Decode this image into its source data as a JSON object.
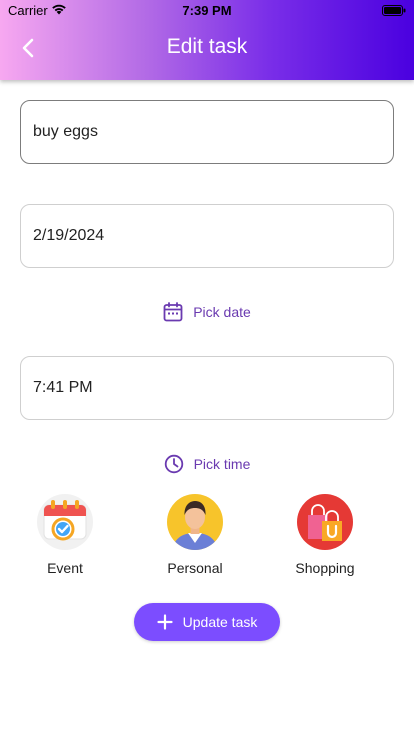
{
  "status_bar": {
    "carrier": "Carrier",
    "time": "7:39 PM"
  },
  "header": {
    "title": "Edit task",
    "back_icon": "chevron-left-icon"
  },
  "form": {
    "task_value": "buy eggs",
    "date_value": "2/19/2024",
    "pick_date_label": "Pick date",
    "time_value": "7:41 PM",
    "pick_time_label": "Pick time"
  },
  "categories": [
    {
      "label": "Event",
      "icon": "calendar-check-icon"
    },
    {
      "label": "Personal",
      "icon": "person-avatar-icon"
    },
    {
      "label": "Shopping",
      "icon": "shopping-bag-icon"
    }
  ],
  "update_button": {
    "label": "Update task",
    "icon": "plus-icon"
  },
  "colors": {
    "accent": "#7c4dff",
    "link": "#6a3ab0",
    "header_gradient_start": "#f7a8f0",
    "header_gradient_end": "#4a00e0"
  }
}
